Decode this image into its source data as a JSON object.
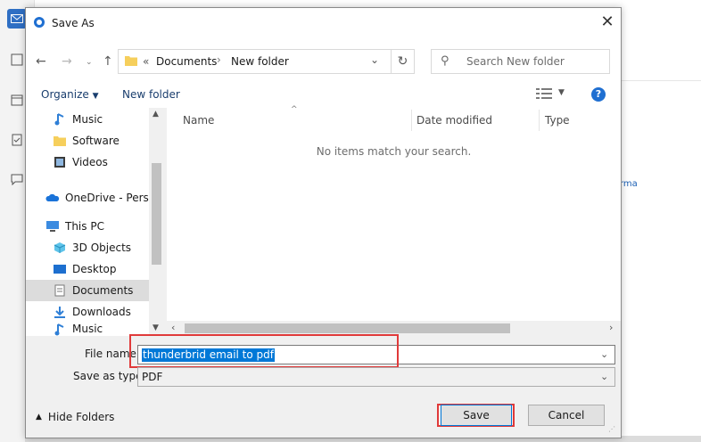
{
  "dialog": {
    "title": "Save As",
    "breadcrumb_sep": "«",
    "breadcrumb": [
      "Documents",
      "New folder"
    ],
    "search_placeholder": "Search New folder",
    "toolbar": {
      "organize": "Organize",
      "new_folder": "New folder"
    },
    "nav_items": [
      {
        "label": "Music",
        "icon": "music-icon"
      },
      {
        "label": "Software",
        "icon": "folder-icon"
      },
      {
        "label": "Videos",
        "icon": "video-icon"
      },
      {
        "label": "OneDrive - Person",
        "icon": "cloud-icon"
      },
      {
        "label": "This PC",
        "icon": "pc-icon"
      },
      {
        "label": "3D Objects",
        "icon": "cube-icon"
      },
      {
        "label": "Desktop",
        "icon": "desktop-icon"
      },
      {
        "label": "Documents",
        "icon": "document-icon",
        "selected": true
      },
      {
        "label": "Downloads",
        "icon": "download-icon"
      },
      {
        "label": "Music",
        "icon": "music-icon"
      }
    ],
    "columns": [
      "Name",
      "Date modified",
      "Type"
    ],
    "empty_message": "No items match your search.",
    "file_name_label": "File name:",
    "file_name_value": "thunderbrid email to pdf",
    "save_type_label": "Save as type:",
    "save_type_value": "PDF",
    "hide_folders": "Hide Folders",
    "save_button": "Save",
    "cancel_button": "Cancel"
  },
  "background": {
    "side_text": "rma"
  },
  "colors": {
    "accent": "#0078d7",
    "highlight": "#e03a3a"
  }
}
